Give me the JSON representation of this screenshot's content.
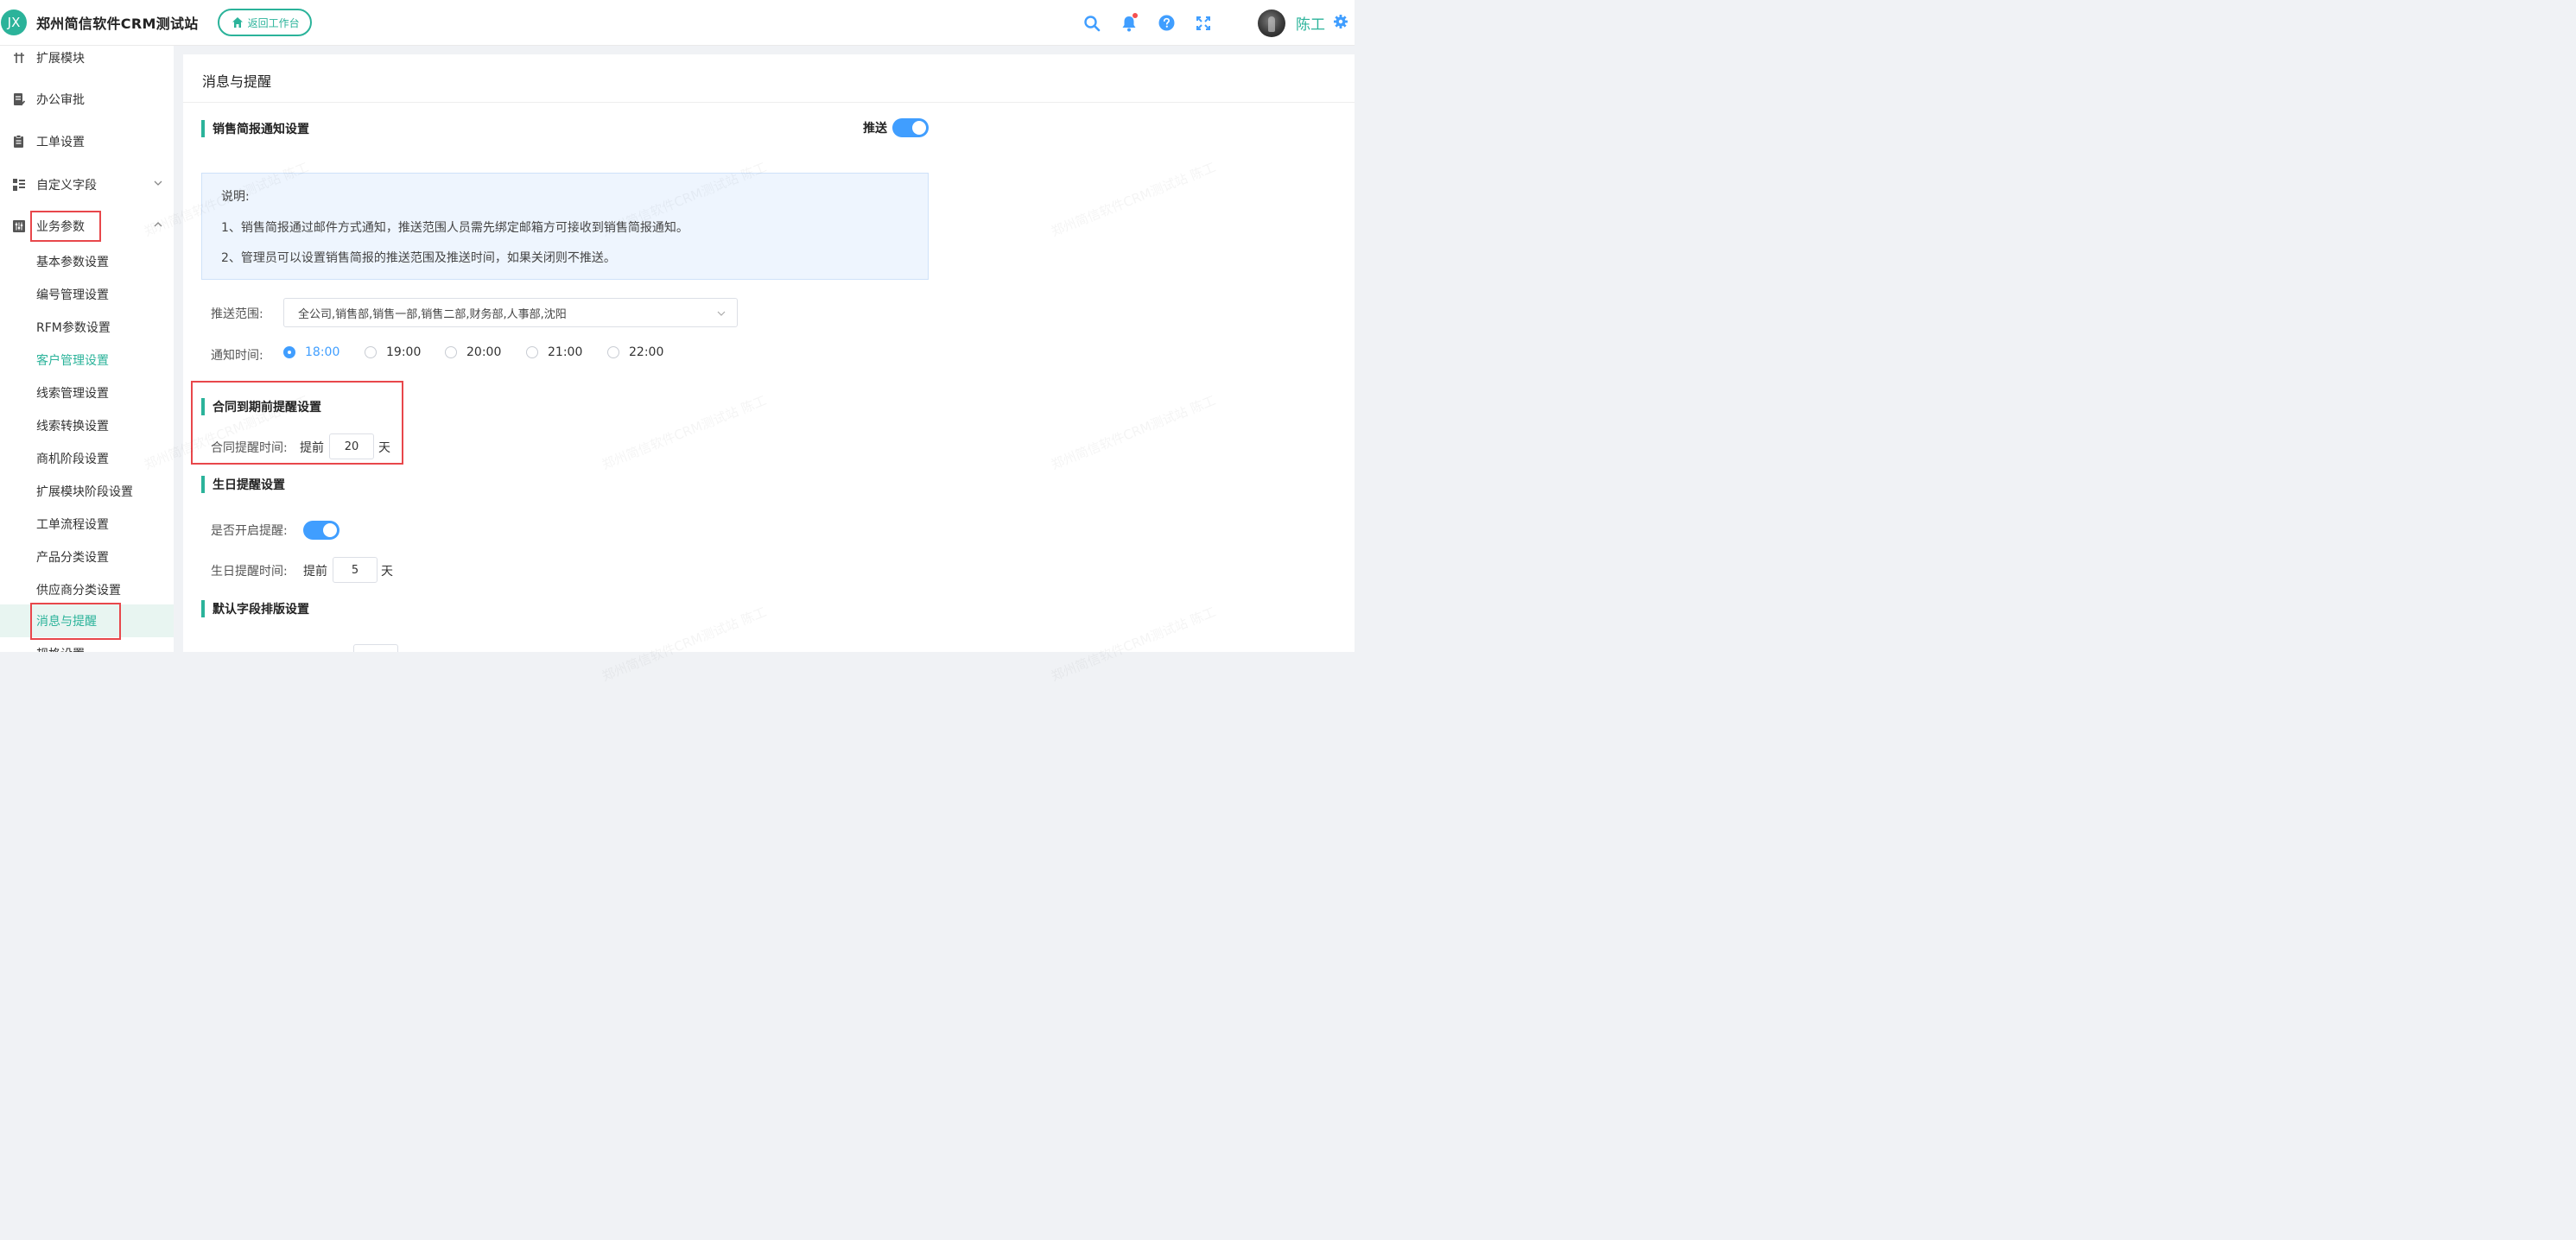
{
  "header": {
    "logo_text": "JX",
    "app_title": "郑州简信软件CRM测试站",
    "back_button": "返回工作台",
    "user_name": "陈工"
  },
  "sidebar": {
    "items": [
      {
        "label": "扩展模块",
        "icon": "extension-icon"
      },
      {
        "label": "办公审批",
        "icon": "approval-icon"
      },
      {
        "label": "工单设置",
        "icon": "clipboard-icon"
      },
      {
        "label": "自定义字段",
        "icon": "grid-list-icon",
        "expanded": false
      },
      {
        "label": "业务参数",
        "icon": "sliders-icon",
        "expanded": true
      }
    ],
    "subitems": [
      "基本参数设置",
      "编号管理设置",
      "RFM参数设置",
      "客户管理设置",
      "线索管理设置",
      "线索转换设置",
      "商机阶段设置",
      "扩展模块阶段设置",
      "工单流程设置",
      "产品分类设置",
      "供应商分类设置",
      "消息与提醒",
      "规格设置"
    ],
    "active_subitem": "消息与提醒",
    "highlight_subitem": "客户管理设置"
  },
  "content": {
    "page_title": "消息与提醒",
    "sales_report": {
      "title": "销售简报通知设置",
      "push_label": "推送",
      "push_enabled": true,
      "note_title": "说明:",
      "note_lines": [
        "1、销售简报通过邮件方式通知，推送范围人员需先绑定邮箱方可接收到销售简报通知。",
        "2、管理员可以设置销售简报的推送范围及推送时间，如果关闭则不推送。"
      ],
      "scope_label": "推送范围:",
      "scope_value": "全公司,销售部,销售一部,销售二部,财务部,人事部,沈阳",
      "time_label": "通知时间:",
      "time_options": [
        "18:00",
        "19:00",
        "20:00",
        "21:00",
        "22:00"
      ],
      "time_selected": "18:00"
    },
    "contract": {
      "title": "合同到期前提醒设置",
      "label": "合同提醒时间:",
      "prefix": "提前",
      "value": "20",
      "unit": "天"
    },
    "birthday": {
      "title": "生日提醒设置",
      "enable_label": "是否开启提醒:",
      "enabled": true,
      "time_label": "生日提醒时间:",
      "prefix": "提前",
      "value": "5",
      "unit": "天"
    },
    "default_layout": {
      "title": "默认字段排版设置"
    }
  },
  "watermark": "郑州简信软件CRM测试站 陈工",
  "colors": {
    "brand": "#2bb39a",
    "primary": "#409eff",
    "highlight_box": "#e8474b"
  }
}
